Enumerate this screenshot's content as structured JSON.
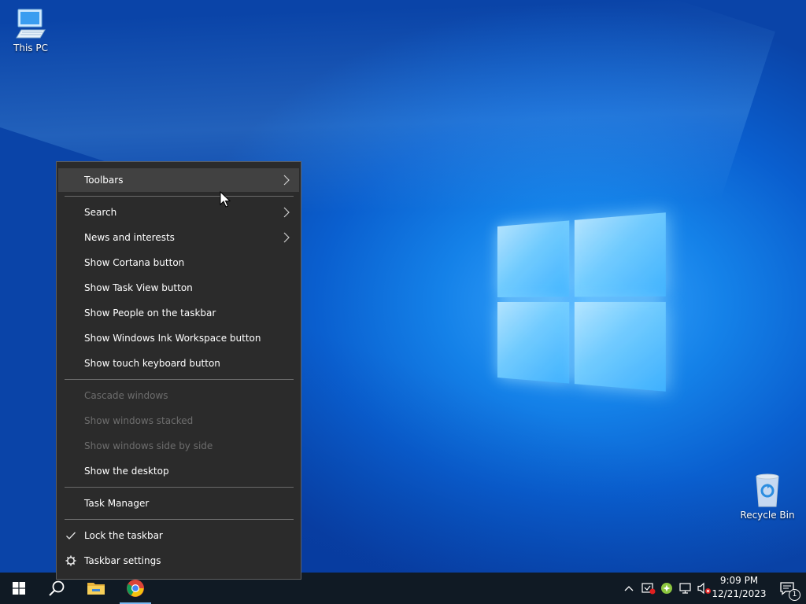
{
  "desktop": {
    "icons": [
      {
        "label": "This PC",
        "icon": "computer-icon"
      },
      {
        "label": "Recycle Bin",
        "icon": "recycle-bin-icon"
      }
    ]
  },
  "context_menu": {
    "items": [
      {
        "label": "Toolbars",
        "submenu": true,
        "hover": true,
        "enabled": true
      },
      {
        "label": "Search",
        "submenu": true,
        "enabled": true
      },
      {
        "label": "News and interests",
        "submenu": true,
        "enabled": true
      },
      {
        "label": "Show Cortana button",
        "enabled": true
      },
      {
        "label": "Show Task View button",
        "enabled": true
      },
      {
        "label": "Show People on the taskbar",
        "enabled": true
      },
      {
        "label": "Show Windows Ink Workspace button",
        "enabled": true
      },
      {
        "label": "Show touch keyboard button",
        "enabled": true
      },
      {
        "label": "Cascade windows",
        "enabled": false
      },
      {
        "label": "Show windows stacked",
        "enabled": false
      },
      {
        "label": "Show windows side by side",
        "enabled": false
      },
      {
        "label": "Show the desktop",
        "enabled": true
      },
      {
        "label": "Task Manager",
        "enabled": true
      },
      {
        "label": "Lock the taskbar",
        "checked": true,
        "enabled": true
      },
      {
        "label": "Taskbar settings",
        "icon": "gear-icon",
        "enabled": true
      }
    ]
  },
  "taskbar": {
    "buttons": [
      {
        "name": "start",
        "icon": "windows-logo-icon"
      },
      {
        "name": "search",
        "icon": "search-icon"
      },
      {
        "name": "file-explorer",
        "icon": "folder-icon"
      },
      {
        "name": "chrome",
        "icon": "chrome-icon",
        "active": true
      }
    ],
    "tray": {
      "icons": [
        "chevron-up-icon",
        "security-alert-icon",
        "green-shield-icon",
        "network-icon",
        "volume-muted-icon"
      ],
      "time": "9:09 PM",
      "date": "12/21/2023",
      "notification_count": "1"
    }
  },
  "colors": {
    "menu_bg": "#2b2b2b",
    "menu_hover": "#414141",
    "taskbar_bg": "#101a24",
    "accent": "#78b8f0"
  }
}
